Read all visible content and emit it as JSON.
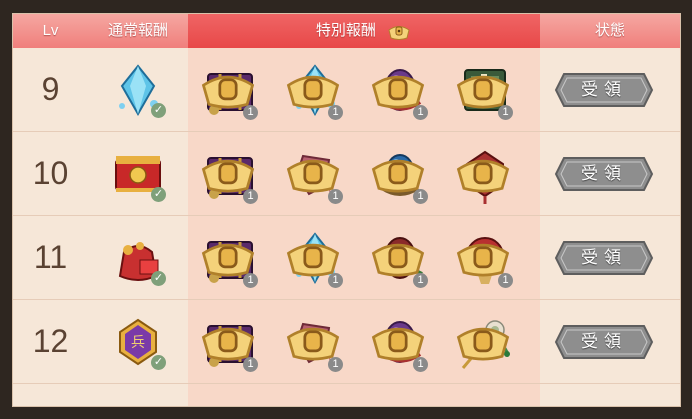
{
  "header": {
    "lv": "Lv",
    "normal_reward": "通常報酬",
    "special_reward": "特別報酬",
    "status": "状態"
  },
  "rows": [
    {
      "level": "9",
      "normal": {
        "icon": "blue-gem-icon"
      },
      "special": [
        {
          "icon": "purple-chest-icon",
          "count": "1"
        },
        {
          "icon": "blue-gem-icon",
          "count": "1"
        },
        {
          "icon": "purple-egg-icon",
          "count": "1"
        },
        {
          "icon": "green-book-icon",
          "count": "1"
        }
      ],
      "button": "受領"
    },
    {
      "level": "10",
      "normal": {
        "icon": "red-chest-icon"
      },
      "special": [
        {
          "icon": "purple-chest-icon",
          "count": "1"
        },
        {
          "icon": "red-gem-icon",
          "count": "1"
        },
        {
          "icon": "blue-egg-icon",
          "count": "1"
        },
        {
          "icon": "red-amulet-icon",
          "count": ""
        }
      ],
      "button": "受領"
    },
    {
      "level": "11",
      "normal": {
        "icon": "red-bag-icon"
      },
      "special": [
        {
          "icon": "purple-chest-icon",
          "count": "1"
        },
        {
          "icon": "blue-gem-icon",
          "count": "1"
        },
        {
          "icon": "red-egg-icon",
          "count": "1"
        },
        {
          "icon": "red-medallion-icon",
          "count": "1"
        }
      ],
      "button": "受領"
    },
    {
      "level": "12",
      "normal": {
        "icon": "purple-amulet-icon"
      },
      "special": [
        {
          "icon": "purple-chest-icon",
          "count": "1"
        },
        {
          "icon": "red-gem-icon",
          "count": "1"
        },
        {
          "icon": "purple-egg-icon",
          "count": "1"
        },
        {
          "icon": "jade-hairpin-icon",
          "count": ""
        }
      ],
      "button": "受領"
    }
  ],
  "colors": {
    "header": "#f07f7c",
    "special_header": "#e84848",
    "panel": "#f6e7d8",
    "special_bg": "#f8d8c8",
    "button": "#8e8e8e"
  }
}
